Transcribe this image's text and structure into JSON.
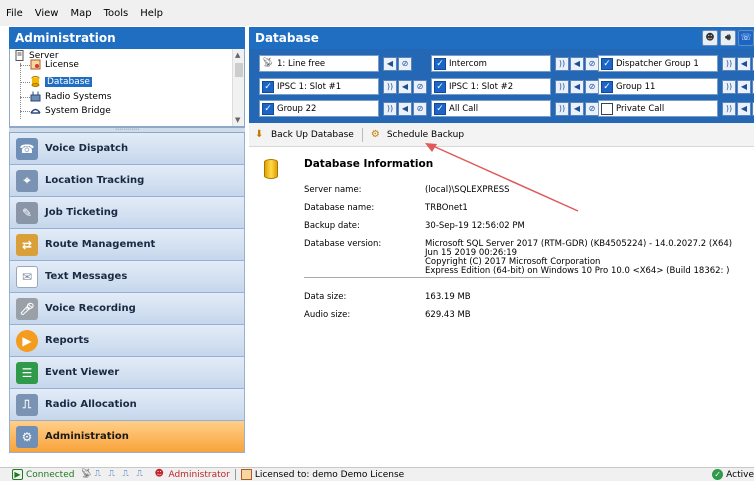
{
  "menu": [
    "File",
    "View",
    "Map",
    "Tools",
    "Help"
  ],
  "left": {
    "title": "Administration",
    "tree": {
      "root": "Server",
      "items": [
        "License",
        "Database",
        "Radio Systems",
        "System Bridge"
      ],
      "selected": "Database"
    },
    "nav": [
      {
        "label": "Voice Dispatch",
        "icon": "voice-dispatch-icon"
      },
      {
        "label": "Location Tracking",
        "icon": "location-tracking-icon"
      },
      {
        "label": "Job Ticketing",
        "icon": "job-ticketing-icon"
      },
      {
        "label": "Route Management",
        "icon": "route-management-icon"
      },
      {
        "label": "Text Messages",
        "icon": "envelope-icon"
      },
      {
        "label": "Voice Recording",
        "icon": "microphone-icon"
      },
      {
        "label": "Reports",
        "icon": "reports-icon"
      },
      {
        "label": "Event Viewer",
        "icon": "event-viewer-icon"
      },
      {
        "label": "Radio Allocation",
        "icon": "radio-allocation-icon"
      },
      {
        "label": "Administration",
        "icon": "administration-icon"
      }
    ],
    "active_nav": "Administration"
  },
  "right": {
    "title": "Database",
    "channels": [
      [
        "1: Line free",
        "Intercom",
        "Dispatcher Group 1"
      ],
      [
        "IPSC 1: Slot #1",
        "IPSC 1: Slot #2",
        "Group 11"
      ],
      [
        "Group 22",
        "All Call",
        "Private Call"
      ]
    ],
    "toolbar": {
      "backup": "Back Up Database",
      "schedule": "Schedule Backup"
    },
    "info": {
      "title": "Database Information",
      "server_label": "Server name:",
      "server_value": "(local)\\SQLEXPRESS",
      "dbname_label": "Database name:",
      "dbname_value": "TRBOnet1",
      "backup_label": "Backup date:",
      "backup_value": "30-Sep-19 12:56:02 PM",
      "version_label": "Database version:",
      "version_line1": "Microsoft SQL Server 2017 (RTM-GDR) (KB4505224) - 14.0.2027.2 (X64)",
      "version_line2": "Jun 15 2019 00:26:19",
      "version_line3": "Copyright (C) 2017 Microsoft Corporation",
      "version_line4": "Express Edition (64-bit) on Windows 10 Pro 10.0 <X64> (Build 18362: )",
      "datasize_label": "Data size:",
      "datasize_value": "163.19 MB",
      "audiosize_label": "Audio size:",
      "audiosize_value": "629.43 MB"
    }
  },
  "status": {
    "connected": "Connected",
    "user": "Administrator",
    "license": "Licensed to: demo Demo License",
    "active": "Active"
  },
  "colors": {
    "header_blue": "#1f6ec2",
    "active_nav": "#f9a33a",
    "arrow": "#e05a5a"
  }
}
